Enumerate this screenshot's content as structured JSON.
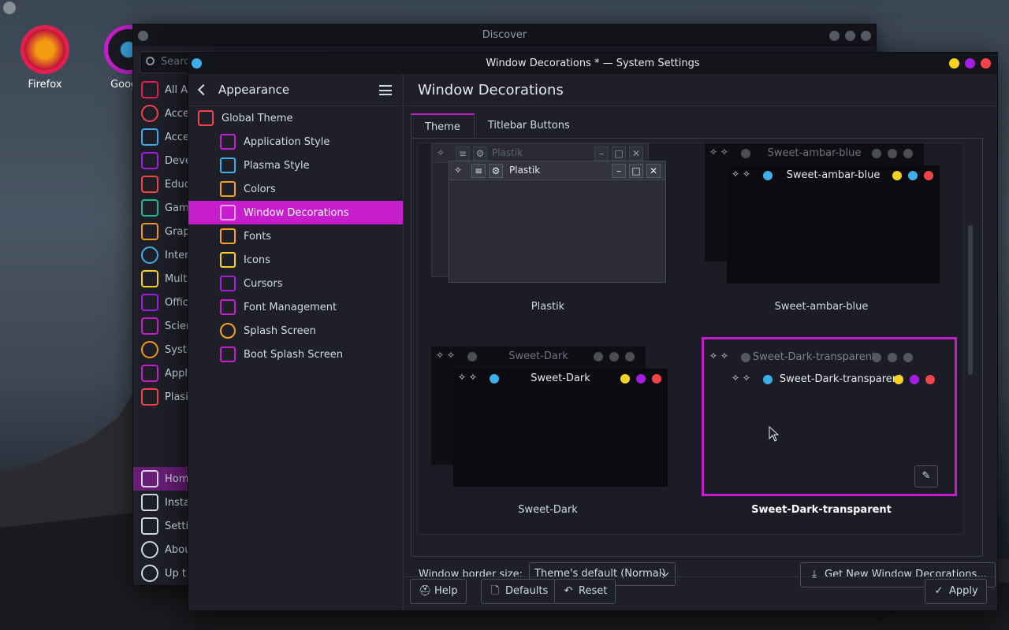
{
  "desktop": {
    "icons": [
      {
        "label": "Firefox"
      },
      {
        "label": "Google"
      }
    ]
  },
  "discover": {
    "title": "Discover",
    "search_placeholder": "Search",
    "categories": [
      "All A",
      "Acce",
      "Acce",
      "Deve",
      "Educ",
      "Gam",
      "Grap",
      "Inter",
      "Mult",
      "Offic",
      "Scien",
      "Syste",
      "Appl",
      "Plasi"
    ],
    "bottom": [
      "Hom",
      "Insta",
      "Setti",
      "Abou",
      "Up t"
    ]
  },
  "settings": {
    "title": "Window Decorations * — System Settings",
    "sidebar": {
      "header": "Appearance",
      "items": [
        {
          "label": "Global Theme"
        },
        {
          "label": "Application Style"
        },
        {
          "label": "Plasma Style"
        },
        {
          "label": "Colors"
        },
        {
          "label": "Window Decorations"
        },
        {
          "label": "Fonts"
        },
        {
          "label": "Icons"
        },
        {
          "label": "Cursors"
        },
        {
          "label": "Font Management"
        },
        {
          "label": "Splash Screen"
        },
        {
          "label": "Boot Splash Screen"
        }
      ]
    },
    "page_title": "Window Decorations",
    "tabs": [
      "Theme",
      "Titlebar Buttons"
    ],
    "themes": [
      {
        "name": "Plastik",
        "preview_title": "Plastik"
      },
      {
        "name": "Sweet-ambar-blue",
        "preview_title": "Sweet-ambar-blue"
      },
      {
        "name": "Sweet-Dark",
        "preview_title": "Sweet-Dark"
      },
      {
        "name": "Sweet-Dark-transparent",
        "preview_title": "Sweet-Dark-transparent"
      }
    ],
    "border_size_label": "Window border size:",
    "border_size_value": "Theme's default (Normal)",
    "get_new_label": "Get New Window Decorations...",
    "footer": {
      "help": "Help",
      "defaults": "Defaults",
      "reset": "Reset",
      "apply": "Apply"
    }
  },
  "colors": {
    "accent": "#c71ecd",
    "yellow": "#f7d320",
    "purple": "#a31ee0",
    "red": "#f2444a",
    "blue": "#3daee9"
  }
}
